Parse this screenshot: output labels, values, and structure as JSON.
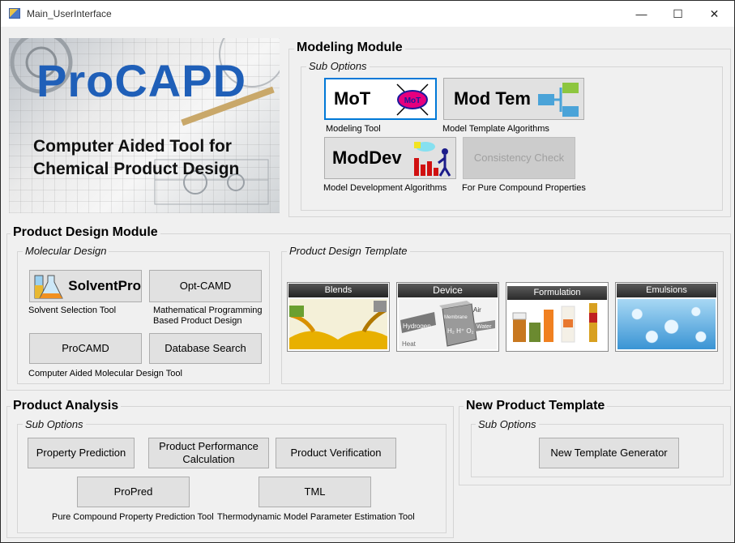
{
  "window": {
    "title": "Main_UserInterface",
    "controls": {
      "minimize": "—",
      "maximize": "☐",
      "close": "✕"
    }
  },
  "logo": {
    "title": "ProCAPD",
    "subtitle_line1": "Computer Aided Tool for",
    "subtitle_line2": "Chemical Product Design"
  },
  "modeling": {
    "title": "Modeling Module",
    "sub_title": "Sub Options",
    "mot": {
      "label": "MoT",
      "icon_text": "MoT",
      "caption": "Modeling Tool"
    },
    "modtem": {
      "label": "Mod Tem",
      "caption": "Model Template Algorithms"
    },
    "moddev": {
      "label": "ModDev",
      "caption": "Model Development Algorithms"
    },
    "consistency": {
      "label": "Consistency Check",
      "caption": "For Pure Compound Properties"
    }
  },
  "product_design": {
    "title": "Product Design Module",
    "molecular": {
      "title": "Molecular Design",
      "solventpro": {
        "label": "SolventPro",
        "caption": "Solvent Selection Tool"
      },
      "optcamd": {
        "label": "Opt-CAMD",
        "caption_line1": "Mathematical Programming",
        "caption_line2": "Based Product Design"
      },
      "procamd": {
        "label": "ProCAMD",
        "caption": "Computer Aided Molecular Design Tool"
      },
      "dbsearch": {
        "label": "Database Search"
      }
    },
    "template": {
      "title": "Product Design Template",
      "cards": [
        "Blends",
        "Device",
        "Formulation",
        "Emulsions"
      ],
      "device_labels": {
        "hydrogen": "Hydrogen",
        "air": "Air",
        "water": "Water",
        "heat": "Heat",
        "membrane": "Membrane",
        "formula": "H₂ H⁺ O₂"
      }
    }
  },
  "analysis": {
    "title": "Product Analysis",
    "sub_title": "Sub Options",
    "property_prediction": "Property Prediction",
    "performance_line1": "Product Performance",
    "performance_line2": "Calculation",
    "verification": "Product Verification",
    "propred": {
      "label": "ProPred",
      "caption": "Pure Compound Property Prediction Tool"
    },
    "tml": {
      "label": "TML",
      "caption": "Thermodynamic Model Parameter Estimation Tool"
    }
  },
  "new_template": {
    "title": "New Product Template",
    "sub_title": "Sub Options",
    "generator": "New Template Generator"
  },
  "colors": {
    "accent": "#0078d7",
    "logo_blue": "#1f5fb8",
    "disabled_text": "#a0a0a0"
  }
}
